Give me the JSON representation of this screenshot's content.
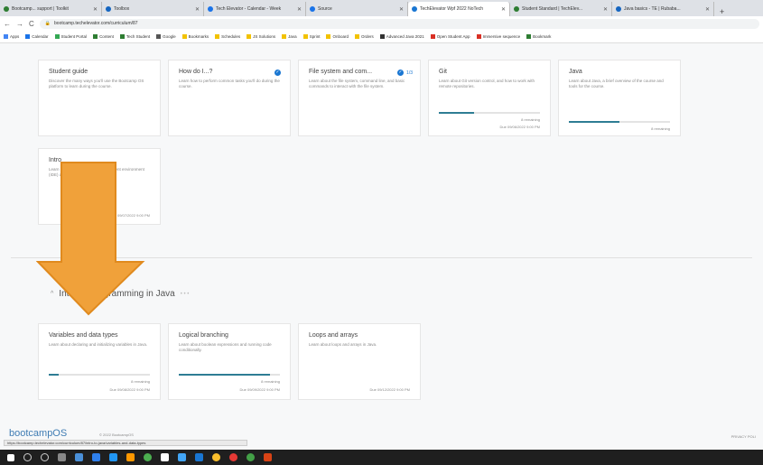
{
  "browser": {
    "tabs": [
      {
        "label": "Bootcamp... support | Toolkit",
        "fav": "#2e7d32"
      },
      {
        "label": "Toolbox",
        "fav": "#1565c0"
      },
      {
        "label": "Tech Elevator - Calendar - Week",
        "fav": "#1a73e8"
      },
      {
        "label": "Source",
        "fav": "#1a73e8"
      },
      {
        "label": "TechElevator Wpf 2022 NoTech",
        "fav": "#1976d2"
      },
      {
        "label": "Student Standard | TechElev...",
        "fav": "#2e7d32"
      },
      {
        "label": "Java basics - TE | Rubaba...",
        "fav": "#1565c0"
      }
    ],
    "new_tab": "+",
    "url": "bootcamp.techelevator.com/curriculum/87",
    "bookmarks": [
      "Apps",
      "Calendar",
      "Student Portal",
      "Content",
      "Tech Student",
      "Google",
      "Bookmarks",
      "Schedules",
      "JS Solutions",
      "Java",
      "Sprint",
      "Onboard",
      "Orders",
      "Advanced Java 2021",
      "Open Student App",
      "Immersive sequence",
      "Bookmark"
    ]
  },
  "cards_row1": [
    {
      "title": "Student guide",
      "desc": "Discover the many ways you'll use the Bootcamp OS platform to learn during the course."
    },
    {
      "title": "How do I...?",
      "desc": "Learn how to perform common tasks you'll do during the course."
    },
    {
      "title": "File system and com...",
      "badge": "1/3",
      "desc": "Learn about the file system, command line, and basic commands to interact with the file system."
    },
    {
      "title": "Git",
      "desc": "Learn about Git version control, and how to work with remote repositories.",
      "remaining": "8 remaining",
      "due": "Due 09/06/2022 9:00 PM",
      "progress": 0.35
    },
    {
      "title": "Java",
      "desc": "Learn about Java, a brief overview of the course and tools for the course.",
      "remaining": "8 remaining",
      "progress": 0.5
    }
  ],
  "cards_row2": [
    {
      "title": "Intro",
      "desc": "Learn about the integrated development environment (IDE) and its use.",
      "due": "Due 09/07/2022 9:00 PM"
    }
  ],
  "section": {
    "title": "Intro to Programming in Java",
    "dots": "• • •"
  },
  "cards_row3": [
    {
      "title": "Variables and data types",
      "desc": "Learn about declaring and initializing variables in Java.",
      "remaining": "8 remaining",
      "due": "Due 09/08/2022 9:00 PM",
      "progress": 0.1
    },
    {
      "title": "Logical branching",
      "desc": "Learn about boolean expressions and running code conditionally.",
      "remaining": "8 remaining",
      "due": "Due 09/09/2022 9:00 PM",
      "progress": 0.9
    },
    {
      "title": "Loops and arrays",
      "desc": "Learn about loops and arrays in Java.",
      "due": "Due 09/12/2022 9:00 PM"
    }
  ],
  "footer": {
    "logo": "bootcampOS",
    "copyright": "© 2022 BootcampOS",
    "privacy": "PRIVACY POLI"
  },
  "status_url": "https://bootcamp.techelevator.com/curriculum/87/intro-to-java/variables-and-data-types",
  "annotation": {
    "arrow_color": "#f0a13a"
  }
}
